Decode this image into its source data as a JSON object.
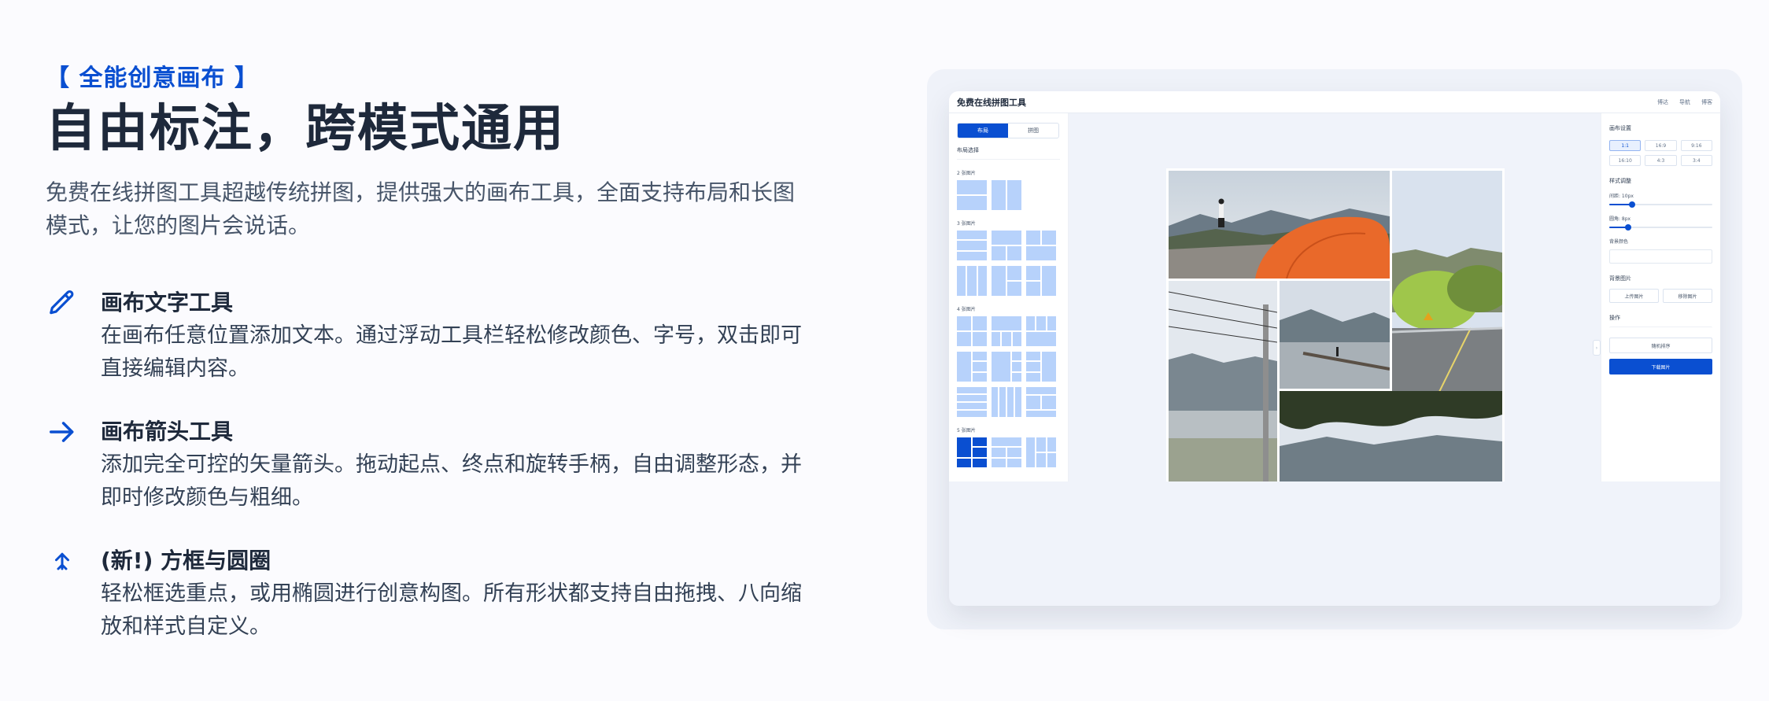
{
  "hero": {
    "eyebrow": "【 全能创意画布 】",
    "headline": "自由标注，跨模式通用",
    "intro": "免费在线拼图工具超越传统拼图，提供强大的画布工具，全面支持布局和长图模式，让您的图片会说话。"
  },
  "features": [
    {
      "icon": "pencil-icon",
      "title": "画布文字工具",
      "desc": "在画布任意位置添加文本。通过浮动工具栏轻松修改颜色、字号，双击即可直接编辑内容。"
    },
    {
      "icon": "arrow-right-icon",
      "title": "画布箭头工具",
      "desc": "添加完全可控的矢量箭头。拖动起点、终点和旋转手柄，自由调整形态，并即时修改颜色与粗细。"
    },
    {
      "icon": "cursor-icon",
      "title": "(新!) 方框与圆圈",
      "desc": "轻松框选重点，或用椭圆进行创意构图。所有形状都支持自由拖拽、八向缩放和样式自定义。"
    }
  ],
  "app": {
    "title": "免费在线拼图工具",
    "nav": [
      "博达",
      "导航",
      "博客"
    ],
    "tabs": [
      "布局",
      "拼图"
    ],
    "layout_label": "布局选择",
    "groups": [
      "2 张图片",
      "3 张图片",
      "4 张图片",
      "5 张图片"
    ],
    "right": {
      "canvas_settings": "画布设置",
      "ratios": [
        "1:1",
        "16:9",
        "9:16",
        "16:10",
        "4:3",
        "3:4"
      ],
      "style_label": "样式调整",
      "spacing": "间距: 10px",
      "radius": "圆角: 8px",
      "bg_color": "背景颜色",
      "bg_image": "背景图片",
      "upload": "上传图片",
      "remove": "移除图片",
      "actions": "操作",
      "shuffle": "随机排序",
      "download": "下载图片"
    },
    "sliders": {
      "spacing": 0.22,
      "radius": 0.18
    }
  },
  "colors": {
    "accent": "#0a4fd1",
    "heading": "#1e293b",
    "body": "#475569"
  }
}
